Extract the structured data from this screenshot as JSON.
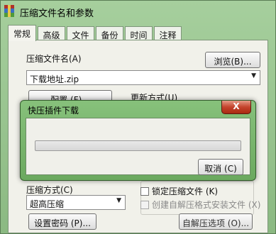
{
  "window": {
    "title": "压缩文件名和参数",
    "tabs": [
      {
        "label": "常规",
        "active": true
      },
      {
        "label": "高级",
        "active": false
      },
      {
        "label": "文件",
        "active": false
      },
      {
        "label": "备份",
        "active": false
      },
      {
        "label": "时间",
        "active": false
      },
      {
        "label": "注释",
        "active": false
      }
    ]
  },
  "general": {
    "archive_name_label": "压缩文件名(A)",
    "browse_button": "浏览(B)...",
    "archive_name_value": "下载地址.zip",
    "profiles_button": "配置 (F)...",
    "update_mode_label": "更新方式(U)",
    "compression_method_label": "压缩方式(C)",
    "compression_method_value": "超高压缩",
    "set_password_button": "设置密码 (P)...",
    "lock_archive_label": "锁定压缩文件 (K)",
    "create_sfx_label": "创建自解压格式安装文件 (X)",
    "sfx_options_button": "自解压选项 (O)..."
  },
  "download_dialog": {
    "title": "快压插件下载",
    "close_glyph": "X",
    "progress": 0.0,
    "cancel_button": "取消 (C)"
  },
  "colors": {
    "window_frame": "#8fbf86",
    "dialog_frame": "#7bb86f",
    "close_button": "#c4432c",
    "progress_fill": "#3fbd3f"
  }
}
